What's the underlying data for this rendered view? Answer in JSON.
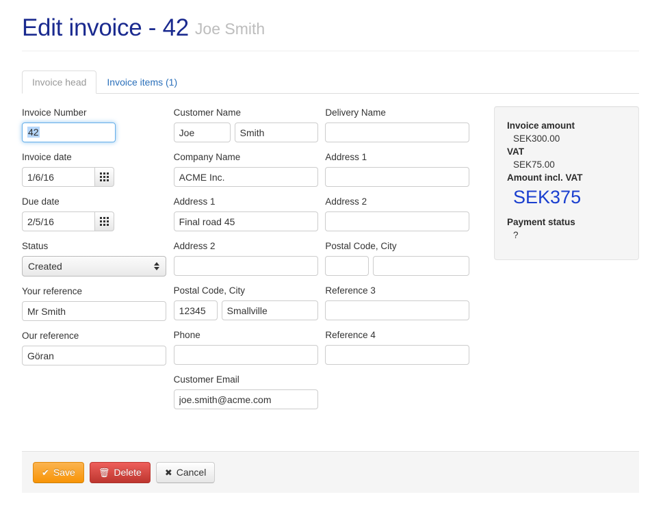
{
  "header": {
    "title": "Edit invoice - 42",
    "subtitle": "Joe Smith",
    "title_color": "#1a2a8f"
  },
  "tabs": [
    {
      "label": "Invoice head",
      "active": true
    },
    {
      "label": "Invoice items (1)",
      "active": false
    }
  ],
  "form": {
    "column_left": {
      "invoice_number": {
        "label": "Invoice Number",
        "value": "42",
        "focused": true,
        "selected": true
      },
      "invoice_date": {
        "label": "Invoice date",
        "value": "1/6/16",
        "picker_icon": "calendar-icon"
      },
      "due_date": {
        "label": "Due date",
        "value": "2/5/16",
        "picker_icon": "calendar-icon"
      },
      "status": {
        "label": "Status",
        "value": "Created"
      },
      "your_reference": {
        "label": "Your reference",
        "value": "Mr Smith"
      },
      "our_reference": {
        "label": "Our reference",
        "value": "Göran"
      }
    },
    "column_middle": {
      "customer_name": {
        "label": "Customer Name",
        "first": "Joe",
        "last": "Smith"
      },
      "company_name": {
        "label": "Company Name",
        "value": "ACME Inc."
      },
      "address_1": {
        "label": "Address 1",
        "value": "Final road 45"
      },
      "address_2": {
        "label": "Address 2",
        "value": ""
      },
      "postal_city": {
        "label": "Postal Code, City",
        "postal": "12345",
        "city": "Smallville"
      },
      "phone": {
        "label": "Phone",
        "value": ""
      },
      "customer_email": {
        "label": "Customer Email",
        "value": "joe.smith@acme.com"
      }
    },
    "column_right": {
      "delivery_name": {
        "label": "Delivery Name",
        "value": ""
      },
      "address_1": {
        "label": "Address 1",
        "value": ""
      },
      "address_2": {
        "label": "Address 2",
        "value": ""
      },
      "postal_city": {
        "label": "Postal Code, City",
        "postal": "",
        "city": ""
      },
      "reference_3": {
        "label": "Reference 3",
        "value": ""
      },
      "reference_4": {
        "label": "Reference 4",
        "value": ""
      }
    }
  },
  "summary": {
    "invoice_amount_label": "Invoice amount",
    "invoice_amount_value": "SEK300.00",
    "vat_label": "VAT",
    "vat_value": "SEK75.00",
    "total_label": "Amount incl. VAT",
    "total_value": "SEK375",
    "total_color": "#1a3fcf",
    "payment_status_label": "Payment status",
    "payment_status_value": "?"
  },
  "footer": {
    "save_label": "Save",
    "save_icon": "check-icon",
    "delete_label": "Delete",
    "delete_icon": "trash-icon",
    "cancel_label": "Cancel",
    "cancel_icon": "close-icon"
  }
}
